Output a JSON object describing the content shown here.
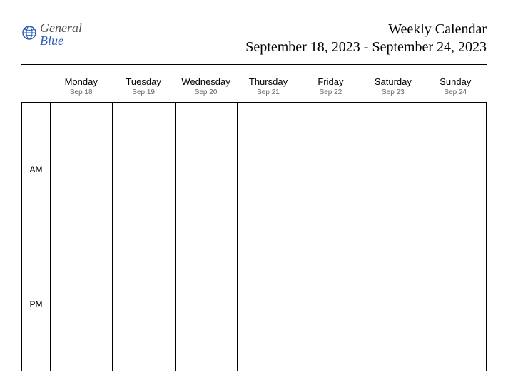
{
  "logo": {
    "word1": "General",
    "word2": "Blue"
  },
  "title": "Weekly Calendar",
  "date_range": "September 18, 2023 - September 24, 2023",
  "row_labels": {
    "am": "AM",
    "pm": "PM"
  },
  "days": [
    {
      "name": "Monday",
      "date": "Sep 18"
    },
    {
      "name": "Tuesday",
      "date": "Sep 19"
    },
    {
      "name": "Wednesday",
      "date": "Sep 20"
    },
    {
      "name": "Thursday",
      "date": "Sep 21"
    },
    {
      "name": "Friday",
      "date": "Sep 22"
    },
    {
      "name": "Saturday",
      "date": "Sep 23"
    },
    {
      "name": "Sunday",
      "date": "Sep 24"
    }
  ]
}
